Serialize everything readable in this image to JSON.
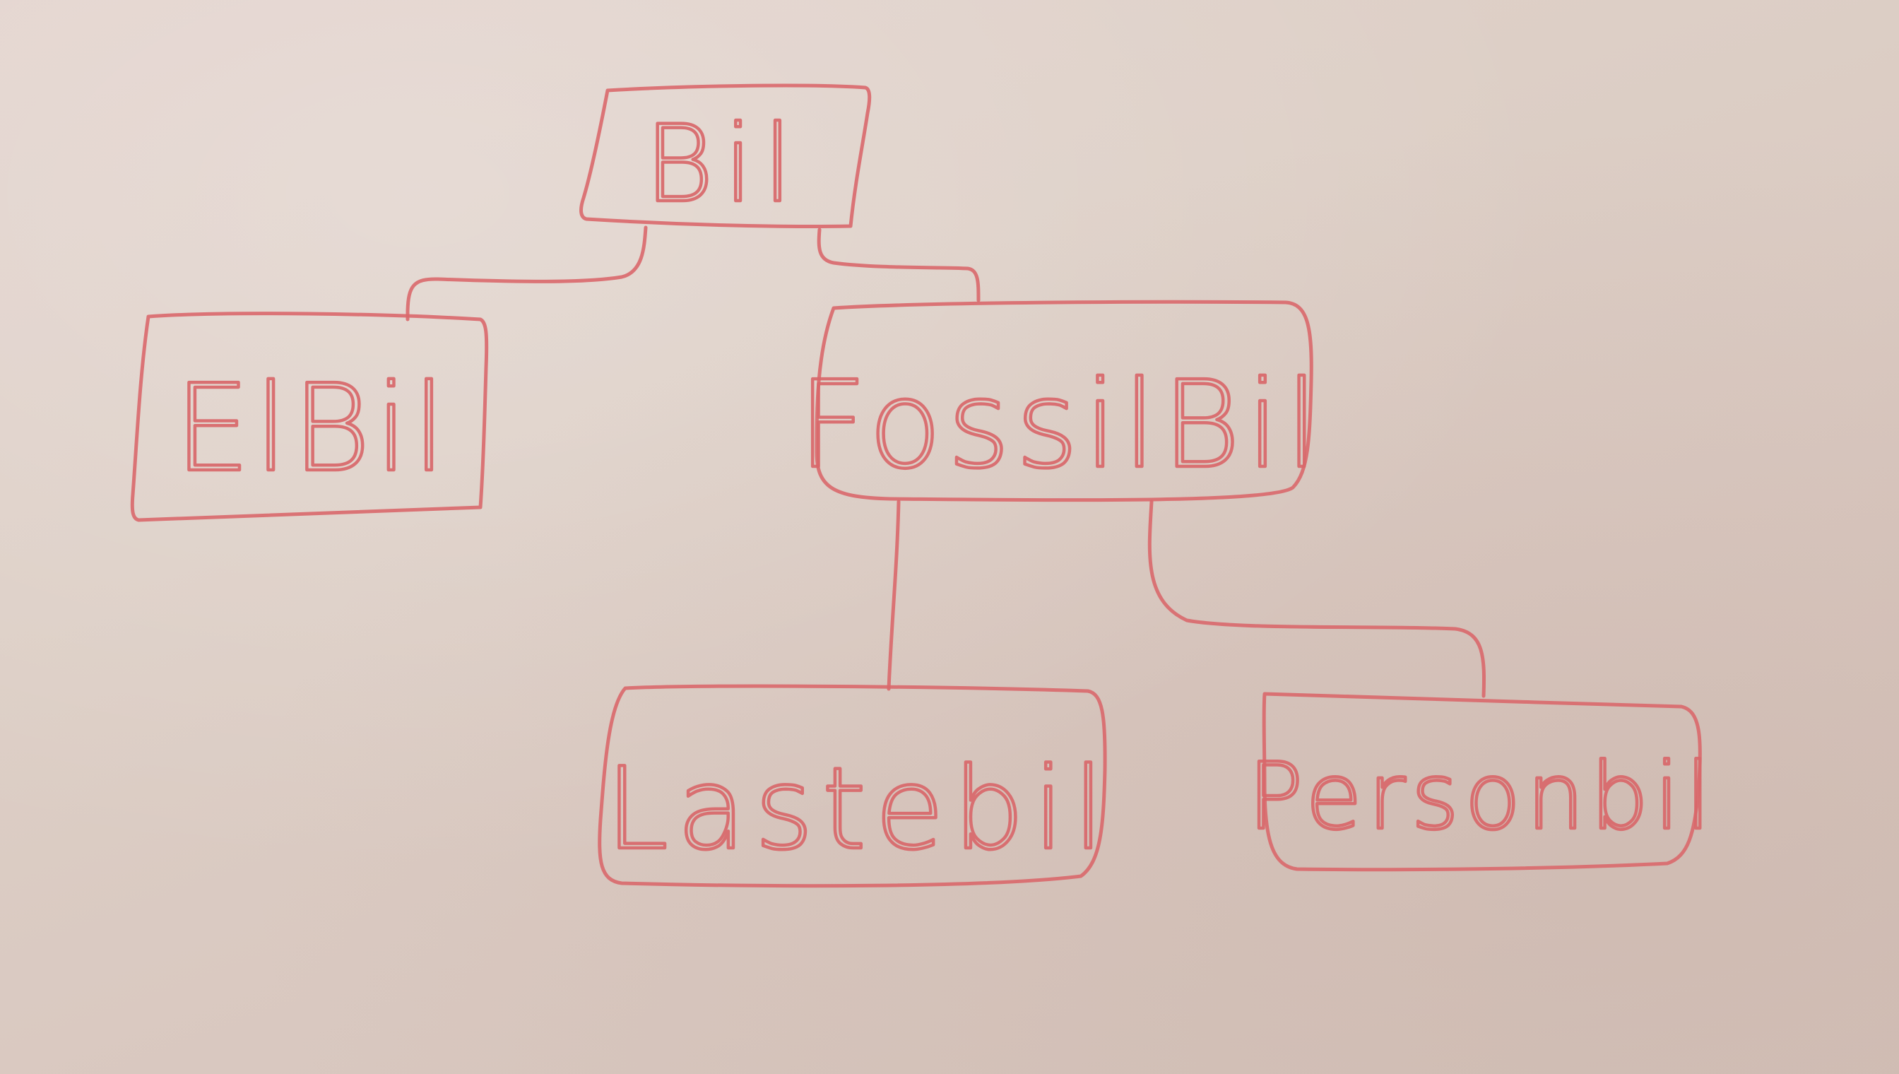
{
  "diagram": {
    "nodes": {
      "bil": {
        "label": "Bil"
      },
      "elbil": {
        "label": "ElBil"
      },
      "fossilbil": {
        "label": "FossilBil"
      },
      "lastebil": {
        "label": "Lastebil"
      },
      "personbil": {
        "label": "Personbil"
      }
    },
    "edges": [
      {
        "from": "bil",
        "to": "elbil"
      },
      {
        "from": "bil",
        "to": "fossilbil"
      },
      {
        "from": "fossilbil",
        "to": "lastebil"
      },
      {
        "from": "fossilbil",
        "to": "personbil"
      }
    ],
    "ink_color": "#d9686b",
    "board_color": "#ddcfc6"
  }
}
